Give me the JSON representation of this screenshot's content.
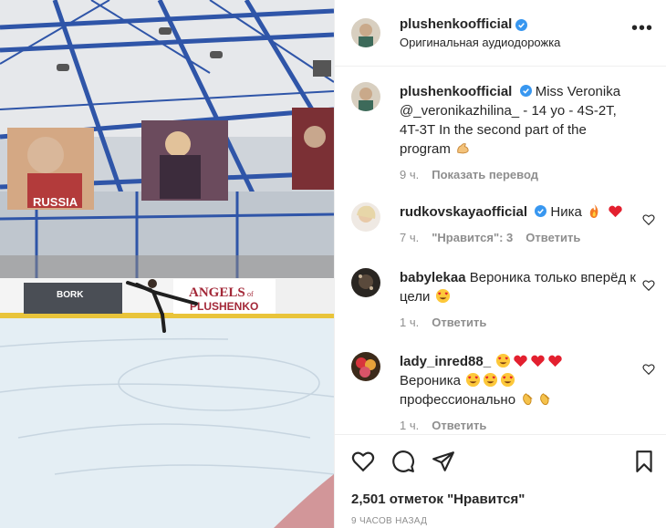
{
  "header": {
    "username": "plushenkoofficial",
    "audio_label": "Оригинальная аудиодорожка",
    "more_icon": "more-horizontal-icon"
  },
  "banners": {
    "angels_brand": "ANGELS",
    "angels_of": "of",
    "angels_name": "PLUSHENKO",
    "bork_brand": "BORK",
    "russia_text": "RUSSIA"
  },
  "caption": {
    "username": "plushenkoofficial",
    "text": "Miss Veronika @_veronikazhilina_ - 14 yo - 4S-2T, 4T-3T In the second part of the program",
    "emoji": "flexed-biceps",
    "time": "9 ч.",
    "translate": "Показать перевод"
  },
  "comments": [
    {
      "username": "rudkovskayaofficial",
      "verified": true,
      "text": "Ника",
      "emojis": [
        "fire",
        "red-heart"
      ],
      "time": "7 ч.",
      "likes": "\"Нравится\": 3",
      "reply": "Ответить"
    },
    {
      "username": "babylekaa",
      "verified": false,
      "text": "Вероника только вперёд к цели",
      "emojis": [
        "heart-eyes"
      ],
      "time": "1 ч.",
      "reply": "Ответить"
    },
    {
      "username": "lady_inred88_",
      "verified": false,
      "text_line1_emojis": [
        "heart-eyes",
        "red-heart",
        "red-heart",
        "red-heart"
      ],
      "text": "Вероника",
      "text_line2_emojis": [
        "heart-eyes",
        "heart-eyes",
        "heart-eyes"
      ],
      "text2": "профессионально",
      "text_line3_emojis": [
        "clapping-hands",
        "clapping-hands"
      ],
      "time": "1 ч.",
      "reply": "Ответить"
    }
  ],
  "actions": {
    "like_icon": "heart-outline-icon",
    "comment_icon": "comment-icon",
    "share_icon": "paper-plane-icon",
    "save_icon": "bookmark-icon"
  },
  "likes_text": "2,501 отметок \"Нравится\"",
  "posted_time": "9 ЧАСОВ НАЗАД",
  "colors": {
    "verified": "#3897f0",
    "meta": "#8e8e8e",
    "text": "#262626",
    "divider": "#efefef"
  }
}
